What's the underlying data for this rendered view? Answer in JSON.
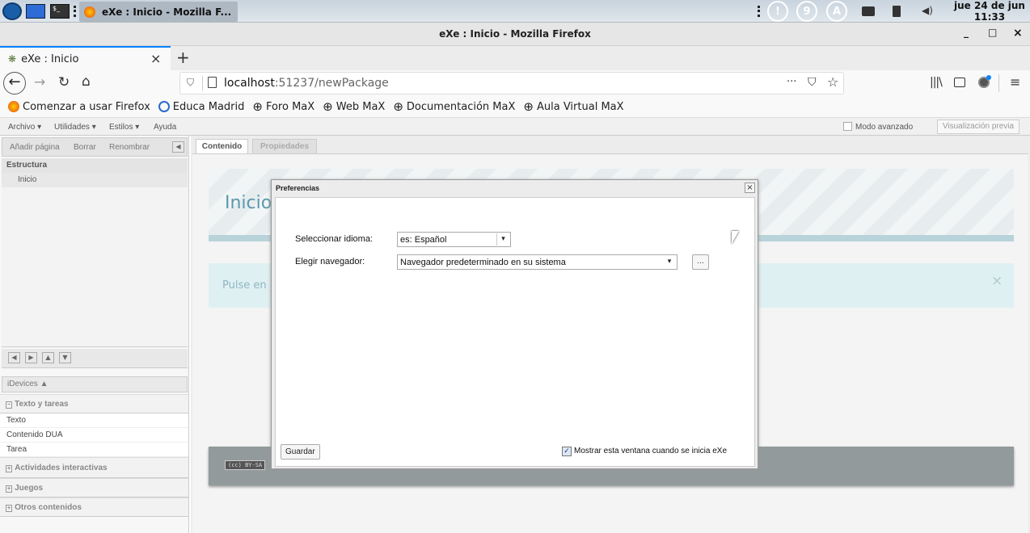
{
  "taskbar": {
    "window_title": "eXe : Inicio - Mozilla F...",
    "date": "jue 24 de jun",
    "time": "11:33",
    "indicators": [
      "!",
      "9",
      "A"
    ]
  },
  "window": {
    "title": "eXe : Inicio - Mozilla Firefox",
    "minimize": "_",
    "maximize": "□",
    "close": "×"
  },
  "tab": {
    "label": "eXe : Inicio",
    "close": "×",
    "new": "+"
  },
  "nav": {
    "url_host": "localhost",
    "url_rest": ":51237/newPackage",
    "more": "···"
  },
  "bookmarks": [
    {
      "label": "Comenzar a usar Firefox",
      "icon": "firefox-icon"
    },
    {
      "label": "Educa Madrid",
      "icon": "educamadrid-icon"
    },
    {
      "label": "Foro MaX",
      "icon": "globe-icon"
    },
    {
      "label": "Web MaX",
      "icon": "globe-icon"
    },
    {
      "label": "Documentación MaX",
      "icon": "globe-icon"
    },
    {
      "label": "Aula Virtual MaX",
      "icon": "globe-icon"
    }
  ],
  "menubar": {
    "archivo": "Archivo ▾",
    "utilidades": "Utilidades ▾",
    "estilos": "Estilos ▾",
    "ayuda": "Ayuda",
    "modo_avanzado": "Modo avanzado",
    "preview": "Visualización previa"
  },
  "outline": {
    "add_page": "Añadir página",
    "delete": "Borrar",
    "rename": "Renombrar",
    "structure_header": "Estructura",
    "nodes": [
      "Inicio"
    ]
  },
  "idevices": {
    "header": "iDevices ▲",
    "categories": [
      {
        "label": "Texto y tareas",
        "expanded": true,
        "items": [
          "Texto",
          "Contenido DUA",
          "Tarea"
        ]
      },
      {
        "label": "Actividades interactivas",
        "expanded": false,
        "items": []
      },
      {
        "label": "Juegos",
        "expanded": false,
        "items": []
      },
      {
        "label": "Otros contenidos",
        "expanded": false,
        "items": []
      }
    ]
  },
  "main_tabs": {
    "content": "Contenido",
    "properties": "Propiedades"
  },
  "page": {
    "title": "Inicio",
    "hint": "Pulse en",
    "hint_close": "×",
    "license": "(cc) BY-SA"
  },
  "dialog": {
    "title": "Preferencias",
    "close": "×",
    "language_label": "Seleccionar idioma:",
    "language_value": "es: Español",
    "browser_label": "Elegir navegador:",
    "browser_value": "Navegador predeterminado en su sistema",
    "browse_button": "...",
    "save_button": "Guardar",
    "show_checkbox_label": "Mostrar esta ventana cuando se inicia eXe",
    "show_checkbox_checked": true
  },
  "colors": {
    "accent_blue": "#0a84ff",
    "header_teal": "#8ec3cf",
    "footer_gray": "#929a9b",
    "hint_bg": "#dff0f3"
  }
}
